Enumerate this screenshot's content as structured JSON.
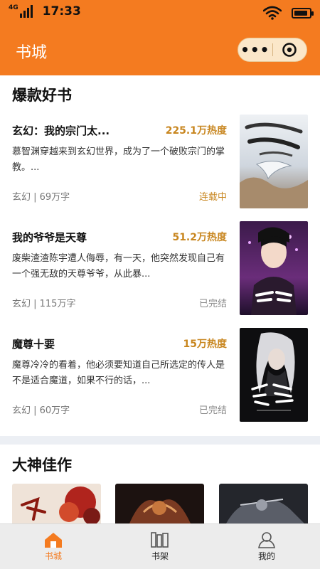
{
  "status_bar": {
    "network": "4G",
    "time": "17:33",
    "battery_level": 0.9
  },
  "nav": {
    "title": "书城",
    "more_label": "•••"
  },
  "sections": {
    "hot": {
      "title": "爆款好书",
      "books": [
        {
          "title": "玄幻：我的宗门太...",
          "heat": "225.1万热度",
          "desc": "慕智渊穿越来到玄幻世界，成为了一个破败宗门的掌教。...",
          "meta": "玄幻 | 69万字",
          "status": "连载中"
        },
        {
          "title": "我的爷爷是天尊",
          "heat": "51.2万热度",
          "desc": "废柴渣渣陈宇遭人侮辱，有一天，他突然发现自己有一个强无敌的天尊爷爷，从此暴...",
          "meta": "玄幻 | 115万字",
          "status": "已完结"
        },
        {
          "title": "魔尊十要",
          "heat": "15万热度",
          "desc": "魔尊冷冷的看着，他必须要知道自己所选定的传人是不是适合魔道，如果不行的话，...",
          "meta": "玄幻 | 60万字",
          "status": "已完结"
        }
      ]
    },
    "master": {
      "title": "大神佳作"
    }
  },
  "tabs": [
    {
      "label": "书城",
      "icon": "home-icon",
      "active": true
    },
    {
      "label": "书架",
      "icon": "bookshelf-icon",
      "active": false
    },
    {
      "label": "我的",
      "icon": "user-icon",
      "active": false
    }
  ],
  "colors": {
    "accent": "#f47b20",
    "heat": "#c8861f"
  }
}
